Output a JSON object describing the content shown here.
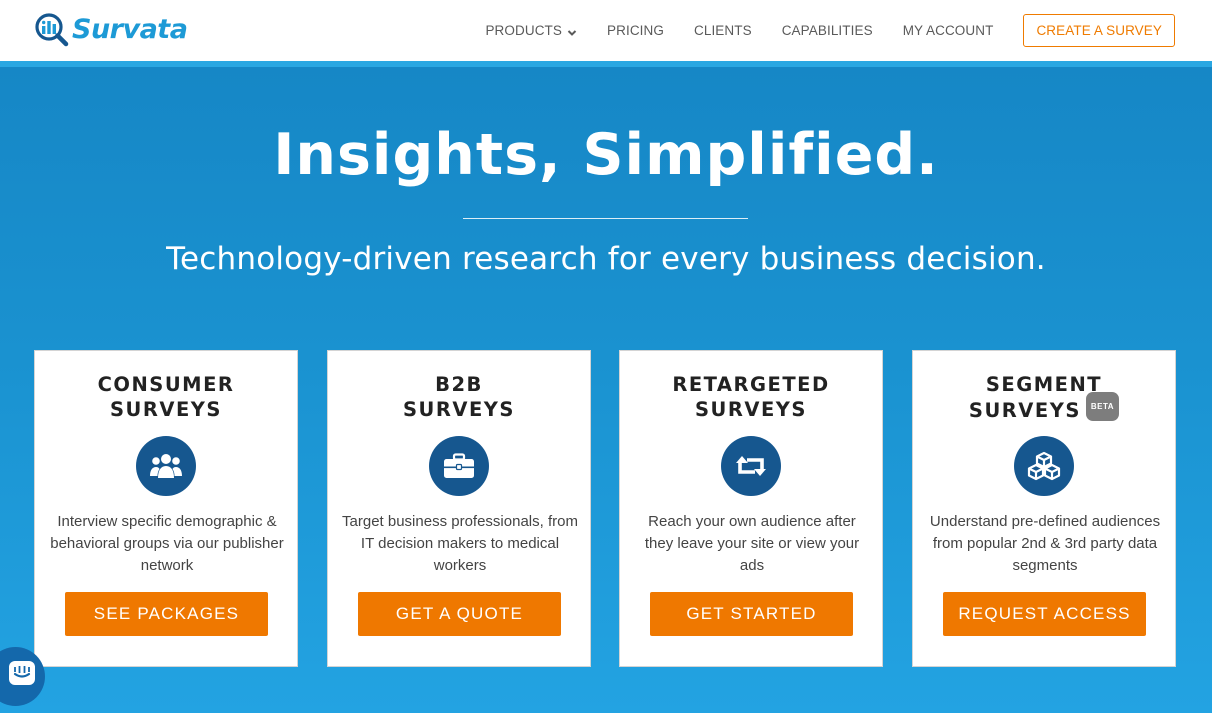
{
  "brand": {
    "name": "Survata",
    "color": "#1d9ad6"
  },
  "nav": {
    "items": [
      {
        "label": "PRODUCTS",
        "has_dropdown": true
      },
      {
        "label": "PRICING"
      },
      {
        "label": "CLIENTS"
      },
      {
        "label": "CAPABILITIES"
      },
      {
        "label": "MY ACCOUNT"
      }
    ],
    "cta_label": "CREATE A SURVEY",
    "cta_color": "#ef7b00"
  },
  "hero": {
    "title": "Insights, Simplified.",
    "subtitle": "Technology-driven research for every business decision."
  },
  "cards": [
    {
      "title_line1": "CONSUMER",
      "title_line2": "SURVEYS",
      "icon": "users-icon",
      "description": "Interview specific demographic & behavioral groups via our publisher network",
      "button_label": "SEE PACKAGES"
    },
    {
      "title_line1": "B2B",
      "title_line2": "SURVEYS",
      "icon": "briefcase-icon",
      "description": "Target business professionals, from IT decision makers to medical workers",
      "button_label": "GET A QUOTE"
    },
    {
      "title_line1": "RETARGETED",
      "title_line2": "SURVEYS",
      "icon": "retweet-icon",
      "description": "Reach your own audience after they leave your site or view your ads",
      "button_label": "GET STARTED"
    },
    {
      "title_line1": "SEGMENT",
      "title_line2": "SURVEYS",
      "badge": "BETA",
      "icon": "cubes-icon",
      "description": "Understand pre-defined audiences from popular 2nd & 3rd party data segments",
      "button_label": "REQUEST ACCESS"
    }
  ],
  "colors": {
    "icon_circle": "#16578f",
    "button": "#ef7800",
    "hero_gradient": [
      "#1687c6",
      "#23a3e2"
    ]
  },
  "chat": {
    "icon": "chat-icon"
  }
}
